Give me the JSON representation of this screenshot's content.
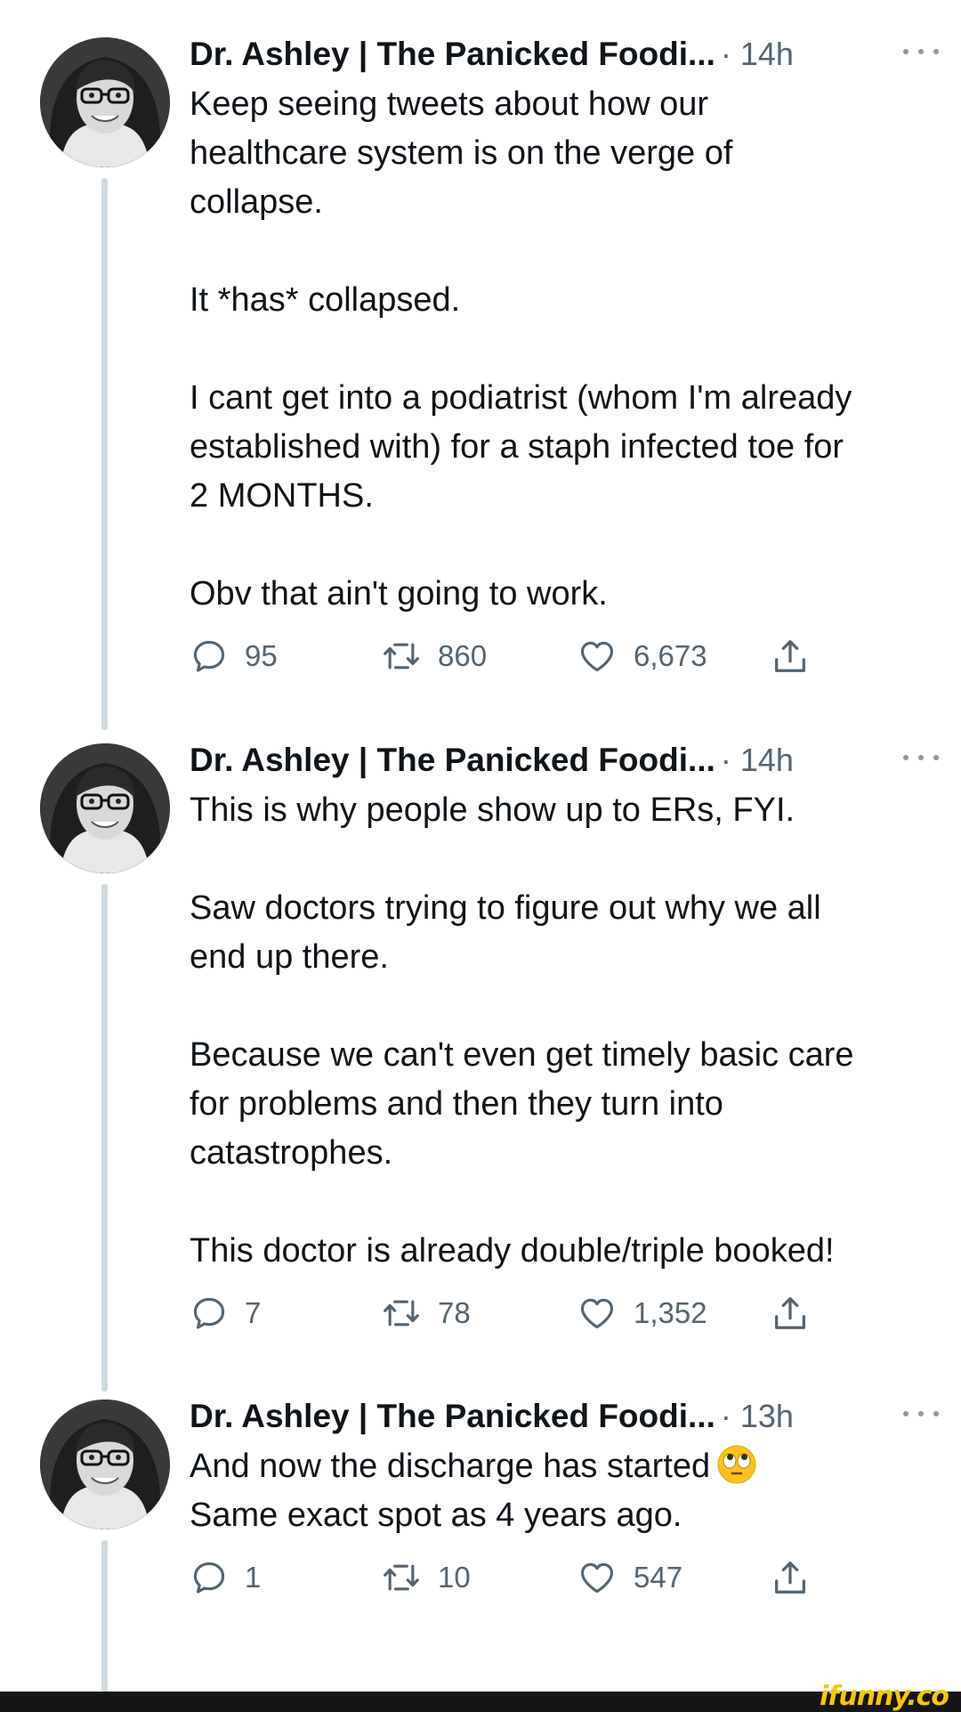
{
  "colors": {
    "text_primary": "#0f1419",
    "text_secondary": "#536471",
    "thread_line": "#cfd9de",
    "footer_bar": "#161616",
    "watermark": "#f6c700"
  },
  "tweets": [
    {
      "author": "Dr. Ashley | The Panicked Foodi...",
      "time": "· 14h",
      "text": "Keep seeing tweets about how our\nhealthcare system is on the verge of\ncollapse.\n\nIt *has* collapsed.\n\nI cant get into a podiatrist (whom I'm already\nestablished with) for a staph infected toe for\n2 MONTHS.\n\nObv that ain't going to work.",
      "replies": "95",
      "retweets": "860",
      "likes": "6,673",
      "icons": [
        "reply-icon",
        "retweet-icon",
        "like-icon",
        "share-icon"
      ]
    },
    {
      "author": "Dr. Ashley | The Panicked Foodi...",
      "time": "· 14h",
      "text": "This is why people show up to ERs, FYI.\n\nSaw doctors trying to figure out why we all\nend up there.\n\nBecause we can't even get timely basic care\nfor problems and then they turn into\ncatastrophes.\n\nThis doctor is already double/triple booked!",
      "replies": "7",
      "retweets": "78",
      "likes": "1,352",
      "icons": [
        "reply-icon",
        "retweet-icon",
        "like-icon",
        "share-icon"
      ]
    },
    {
      "author": "Dr. Ashley | The Panicked Foodi...",
      "time": "· 13h",
      "text_line1": "And now the discharge has started",
      "emoji": "face-with-rolling-eyes-emoji",
      "text_rest": "\nSame exact spot as 4 years ago.",
      "replies": "1",
      "retweets": "10",
      "likes": "547",
      "icons": [
        "reply-icon",
        "retweet-icon",
        "like-icon",
        "share-icon"
      ]
    }
  ],
  "footer": {
    "watermark": "ifunny.co"
  }
}
